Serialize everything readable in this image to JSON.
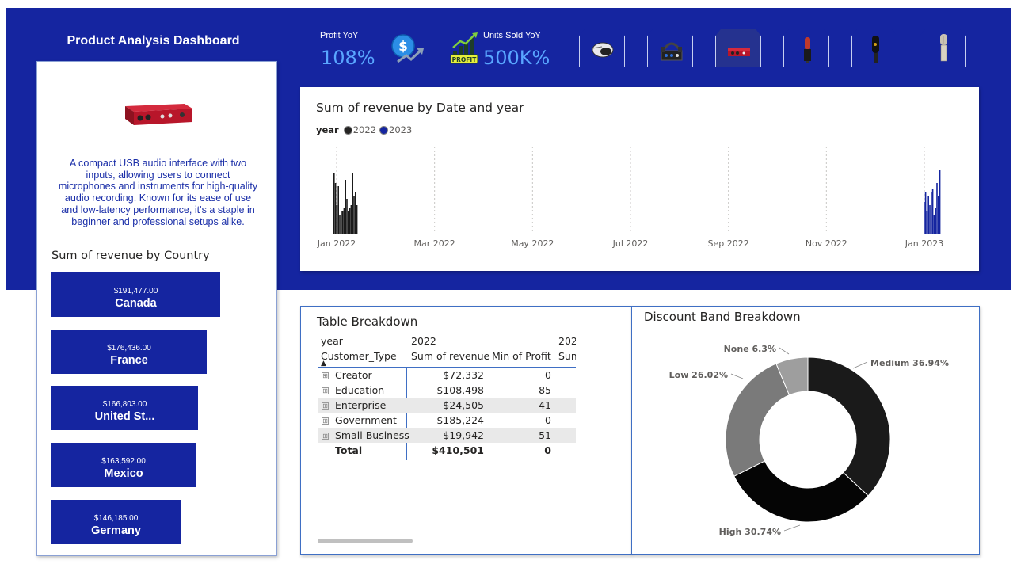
{
  "header": {
    "title": "Product Analysis Dashboard"
  },
  "kpis": {
    "profit": {
      "label": "Profit YoY",
      "value": "108%",
      "icon": "dollar-growth-icon"
    },
    "units": {
      "label": "Units Sold YoY",
      "value": "500K%",
      "icon": "profit-chart-icon"
    }
  },
  "products": [
    {
      "name": "mouse-product",
      "icon": "mouse-icon",
      "selected": false
    },
    {
      "name": "mixer-product",
      "icon": "mixer-icon",
      "selected": false
    },
    {
      "name": "audio-interface-product",
      "icon": "audio-interface-icon",
      "selected": true
    },
    {
      "name": "microphone-red-product",
      "icon": "microphone-icon",
      "selected": false
    },
    {
      "name": "microphone-black-product",
      "icon": "microphone-icon",
      "selected": false
    },
    {
      "name": "microphone-silver-product",
      "icon": "microphone-icon",
      "selected": false
    }
  ],
  "product_detail": {
    "image": "audio-interface-icon",
    "description": "A compact USB audio interface with two inputs, allowing users to connect microphones and instruments for high-quality audio recording. Known for its ease of use and low-latency performance, it's a staple in beginner and professional setups alike."
  },
  "country_revenue": {
    "title": "Sum of revenue by Country",
    "items": [
      {
        "amount": "$191,477.00",
        "country": "Canada",
        "value": 191477
      },
      {
        "amount": "$176,436.00",
        "country": "France",
        "value": 176436
      },
      {
        "amount": "$166,803.00",
        "country": "United St...",
        "value": 166803
      },
      {
        "amount": "$163,592.00",
        "country": "Mexico",
        "value": 163592
      },
      {
        "amount": "$146,185.00",
        "country": "Germany",
        "value": 146185
      }
    ]
  },
  "revenue_chart": {
    "title": "Sum of revenue by Date and year",
    "legend_title": "year",
    "legend": [
      {
        "label": "2022",
        "color": "#252423"
      },
      {
        "label": "2023",
        "color": "#1525a0"
      }
    ]
  },
  "chart_data": {
    "type": "bar",
    "title": "Sum of revenue by Date and year",
    "x_ticks": [
      "Jan 2022",
      "Mar 2022",
      "May 2022",
      "Jul 2022",
      "Sep 2022",
      "Nov 2022",
      "Jan 2023"
    ],
    "grid": true,
    "series": [
      {
        "name": "2022",
        "color": "#1a1a1a",
        "values": [
          95,
          80,
          45,
          75,
          30,
          35,
          35,
          40,
          85,
          55,
          35,
          40,
          45,
          95,
          60,
          65,
          45
        ]
      },
      {
        "name": "2023",
        "color": "#1525a0",
        "values": [
          50,
          65,
          35,
          60,
          45,
          65,
          70,
          30,
          40,
          80,
          60,
          100
        ]
      }
    ]
  },
  "table": {
    "title": "Table Breakdown",
    "year_header": "year",
    "year_2022": "2022",
    "year_2023_partial": "202",
    "row_header": "Customer_Type",
    "sort_indicator": "▲",
    "col_revenue": "Sum of revenue",
    "col_profit": "Min of Profit",
    "col_next_partial": "Sum",
    "expand_glyph": "⊞",
    "rows": [
      {
        "type": "Creator",
        "revenue": "$72,332",
        "profit": "0"
      },
      {
        "type": "Education",
        "revenue": "$108,498",
        "profit": "85"
      },
      {
        "type": "Enterprise",
        "revenue": "$24,505",
        "profit": "41"
      },
      {
        "type": "Government",
        "revenue": "$185,224",
        "profit": "0"
      },
      {
        "type": "Small Business",
        "revenue": "$19,942",
        "profit": "51"
      }
    ],
    "total": {
      "label": "Total",
      "revenue": "$410,501",
      "profit": "0"
    }
  },
  "discount": {
    "title": "Discount Band Breakdown",
    "slices": [
      {
        "label": "Medium 36.94%",
        "value": 36.94,
        "color": "#1a1a1a"
      },
      {
        "label": "High 30.74%",
        "value": 30.74,
        "color": "#050505"
      },
      {
        "label": "Low 26.02%",
        "value": 26.02,
        "color": "#7a7a7a"
      },
      {
        "label": "None 6.3%",
        "value": 6.3,
        "color": "#9e9e9e"
      }
    ]
  },
  "colors": {
    "brand": "#1525a0",
    "kpi_value": "#59a6ff",
    "description_text": "#1a2ea8"
  }
}
